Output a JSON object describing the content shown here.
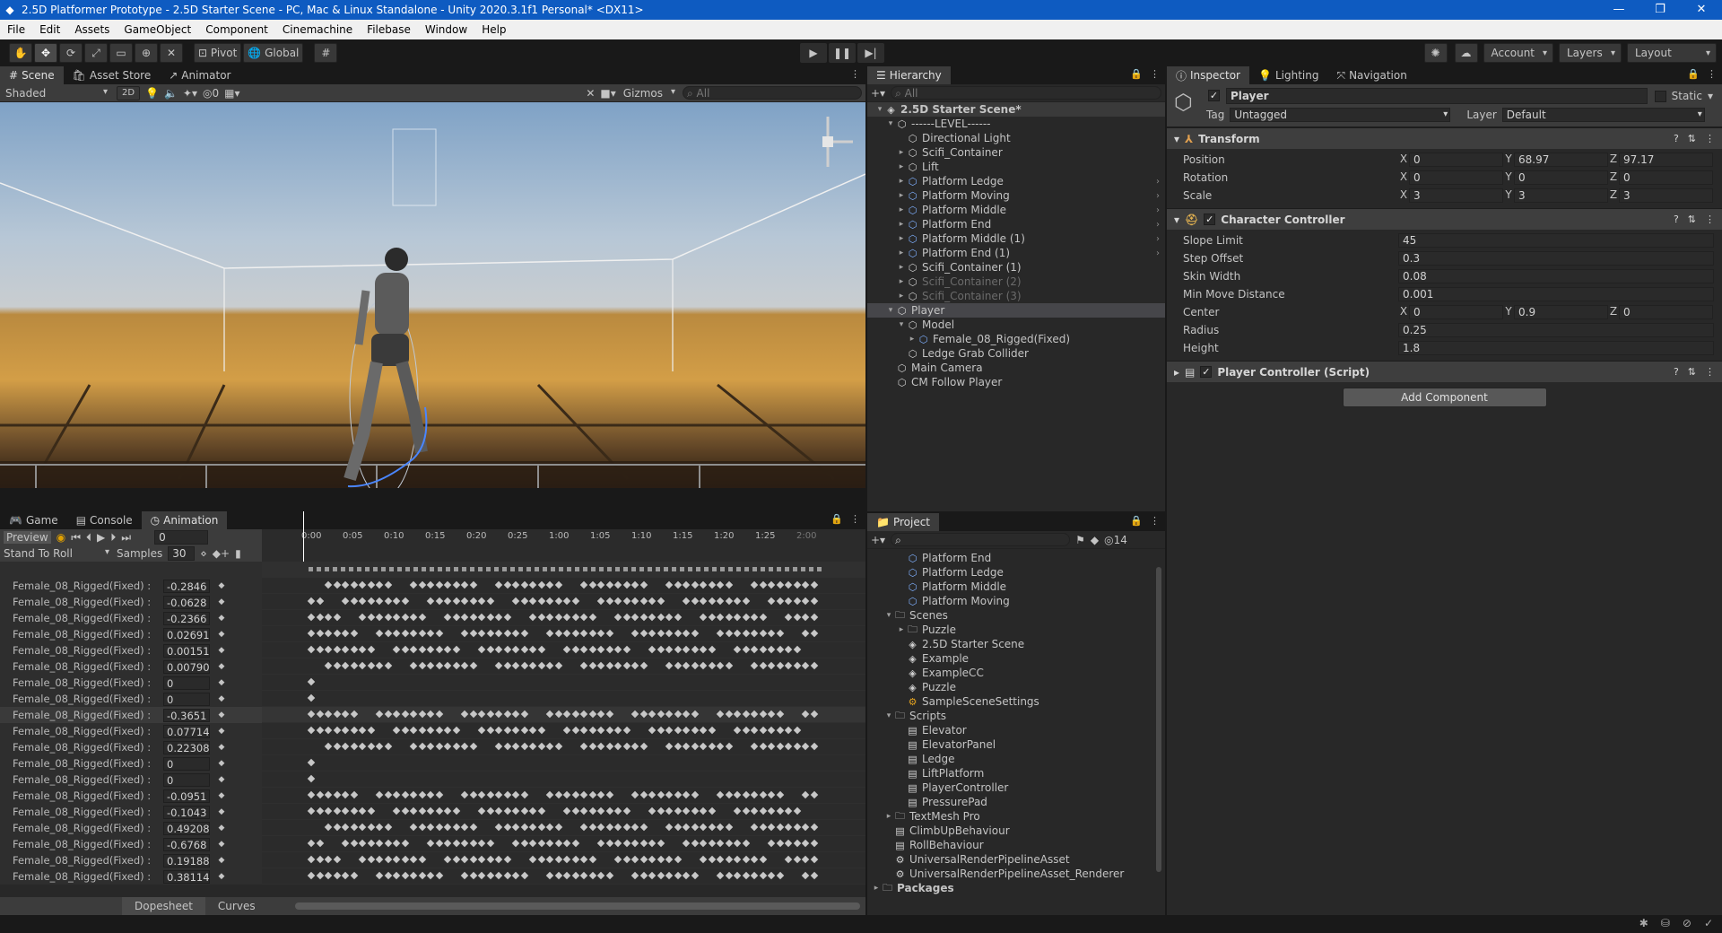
{
  "window": {
    "title": "2.5D Platformer Prototype - 2.5D Starter Scene - PC, Mac & Linux Standalone - Unity 2020.3.1f1 Personal* <DX11>",
    "minimize": "—",
    "maximize": "❐",
    "close": "✕"
  },
  "menu": [
    "File",
    "Edit",
    "Assets",
    "GameObject",
    "Component",
    "Cinemachine",
    "Filebase",
    "Window",
    "Help"
  ],
  "toolbar": {
    "pivot": "Pivot",
    "global": "Global",
    "account": "Account",
    "layers": "Layers",
    "layout": "Layout"
  },
  "scene": {
    "tabs": [
      "Scene",
      "Asset Store",
      "Animator"
    ],
    "shading": "Shaded",
    "mode2d": "2D",
    "fx_count": "0",
    "gizmos": "Gizmos",
    "search_placeholder": "All"
  },
  "animation": {
    "tabs": [
      "Game",
      "Console",
      "Animation"
    ],
    "preview": "Preview",
    "frame": "0",
    "clip": "Stand To Roll",
    "samples_label": "Samples",
    "samples": "30",
    "timeline": [
      "0:00",
      "0:05",
      "0:10",
      "0:15",
      "0:20",
      "0:25",
      "1:00",
      "1:05",
      "1:10",
      "1:15",
      "1:20",
      "1:25",
      "2:00"
    ],
    "property_name": "Female_08_Rigged(Fixed) :",
    "values": [
      "-0.2846",
      "-0.0628",
      "-0.2366",
      "0.02691",
      "0.00151",
      "0.00790",
      "0",
      "0",
      "-0.3651",
      "0.07714",
      "0.22308",
      "0",
      "0",
      "-0.0951",
      "-0.1043",
      "0.49208",
      "-0.6768",
      "0.19188",
      "0.38114"
    ],
    "bottom_tabs": [
      "Dopesheet",
      "Curves"
    ]
  },
  "hierarchy": {
    "tab": "Hierarchy",
    "search_placeholder": "All",
    "items": [
      {
        "label": "2.5D Starter Scene*",
        "indent": 0
      },
      {
        "label": "------LEVEL------",
        "indent": 1
      },
      {
        "label": "Directional Light",
        "indent": 2
      },
      {
        "label": "Scifi_Container",
        "indent": 2
      },
      {
        "label": "Lift",
        "indent": 2
      },
      {
        "label": "Platform Ledge",
        "indent": 2
      },
      {
        "label": "Platform Moving",
        "indent": 2
      },
      {
        "label": "Platform Middle",
        "indent": 2
      },
      {
        "label": "Platform End",
        "indent": 2
      },
      {
        "label": "Platform Middle (1)",
        "indent": 2
      },
      {
        "label": "Platform End (1)",
        "indent": 2
      },
      {
        "label": "Scifi_Container (1)",
        "indent": 2
      },
      {
        "label": "Scifi_Container (2)",
        "indent": 2
      },
      {
        "label": "Scifi_Container (3)",
        "indent": 2
      },
      {
        "label": "Player",
        "indent": 1
      },
      {
        "label": "Model",
        "indent": 2
      },
      {
        "label": "Female_08_Rigged(Fixed)",
        "indent": 3
      },
      {
        "label": "Ledge Grab Collider",
        "indent": 2
      },
      {
        "label": "Main Camera",
        "indent": 1
      },
      {
        "label": "CM Follow Player",
        "indent": 1
      }
    ]
  },
  "project": {
    "tab": "Project",
    "hidden_count": "14",
    "items": [
      {
        "label": "Platform End",
        "indent": 2,
        "icon": "prefab"
      },
      {
        "label": "Platform Ledge",
        "indent": 2,
        "icon": "prefab"
      },
      {
        "label": "Platform Middle",
        "indent": 2,
        "icon": "prefab"
      },
      {
        "label": "Platform Moving",
        "indent": 2,
        "icon": "prefab"
      },
      {
        "label": "Scenes",
        "indent": 1,
        "icon": "folder"
      },
      {
        "label": "Puzzle",
        "indent": 2,
        "icon": "folder"
      },
      {
        "label": "2.5D Starter Scene",
        "indent": 2,
        "icon": "scene"
      },
      {
        "label": "Example",
        "indent": 2,
        "icon": "scene"
      },
      {
        "label": "ExampleCC",
        "indent": 2,
        "icon": "scene"
      },
      {
        "label": "Puzzle",
        "indent": 2,
        "icon": "scene"
      },
      {
        "label": "SampleSceneSettings",
        "indent": 2,
        "icon": "settings"
      },
      {
        "label": "Scripts",
        "indent": 1,
        "icon": "folder"
      },
      {
        "label": "Elevator",
        "indent": 2,
        "icon": "script"
      },
      {
        "label": "ElevatorPanel",
        "indent": 2,
        "icon": "script"
      },
      {
        "label": "Ledge",
        "indent": 2,
        "icon": "script"
      },
      {
        "label": "LiftPlatform",
        "indent": 2,
        "icon": "script"
      },
      {
        "label": "PlayerController",
        "indent": 2,
        "icon": "script"
      },
      {
        "label": "PressurePad",
        "indent": 2,
        "icon": "script"
      },
      {
        "label": "TextMesh Pro",
        "indent": 1,
        "icon": "folder"
      },
      {
        "label": "ClimbUpBehaviour",
        "indent": 1,
        "icon": "script"
      },
      {
        "label": "RollBehaviour",
        "indent": 1,
        "icon": "script"
      },
      {
        "label": "UniversalRenderPipelineAsset",
        "indent": 1,
        "icon": "asset"
      },
      {
        "label": "UniversalRenderPipelineAsset_Renderer",
        "indent": 1,
        "icon": "asset"
      },
      {
        "label": "Packages",
        "indent": 0,
        "icon": "folder"
      }
    ]
  },
  "inspector": {
    "tabs": [
      "Inspector",
      "Lighting",
      "Navigation"
    ],
    "object_name": "Player",
    "static": "Static",
    "tag_label": "Tag",
    "tag": "Untagged",
    "layer_label": "Layer",
    "layer": "Default",
    "transform": {
      "title": "Transform",
      "position_label": "Position",
      "position": [
        "0",
        "68.97",
        "97.17"
      ],
      "rotation_label": "Rotation",
      "rotation": [
        "0",
        "0",
        "0"
      ],
      "scale_label": "Scale",
      "scale": [
        "3",
        "3",
        "3"
      ]
    },
    "character_controller": {
      "title": "Character Controller",
      "slope_limit_label": "Slope Limit",
      "slope_limit": "45",
      "step_offset_label": "Step Offset",
      "step_offset": "0.3",
      "skin_width_label": "Skin Width",
      "skin_width": "0.08",
      "min_move_label": "Min Move Distance",
      "min_move": "0.001",
      "center_label": "Center",
      "center": [
        "0",
        "0.9",
        "0"
      ],
      "radius_label": "Radius",
      "radius": "0.25",
      "height_label": "Height",
      "height": "1.8"
    },
    "player_controller": {
      "title": "Player Controller (Script)"
    },
    "add_component": "Add Component"
  }
}
